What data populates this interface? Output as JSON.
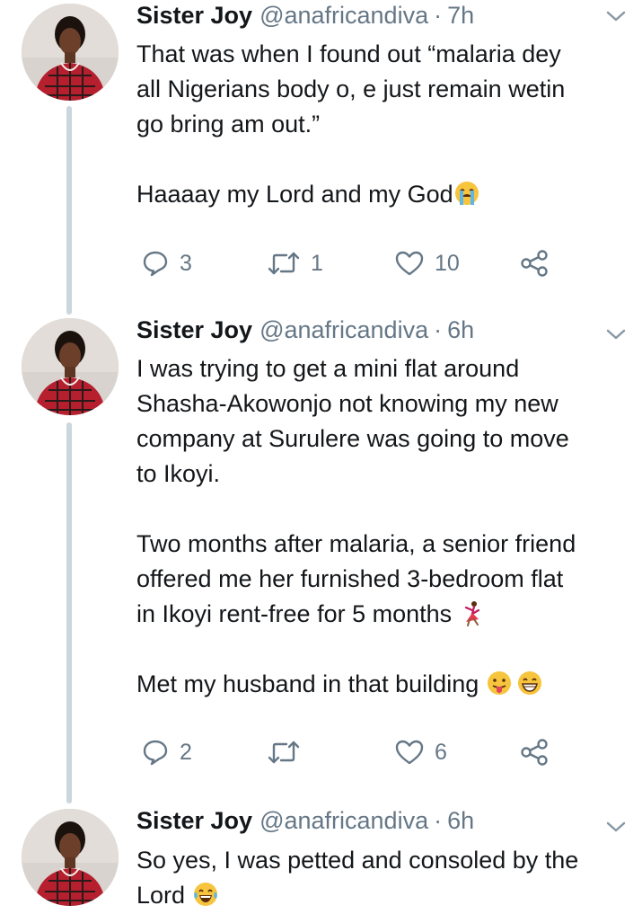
{
  "tweets": [
    {
      "name": "Sister Joy",
      "handle": "@anafricandiva",
      "separator": "·",
      "time": "7h",
      "lines": [
        "That was when I found out “malaria dey",
        "all Nigerians body o, e just remain wetin",
        "go bring am out.”",
        "",
        "Haaaay my Lord and my God"
      ],
      "emojis": [
        "crying-face"
      ],
      "replies": "3",
      "retweets": "1",
      "likes": "10"
    },
    {
      "name": "Sister Joy",
      "handle": "@anafricandiva",
      "separator": "·",
      "time": "6h",
      "lines": [
        "I was trying to get a mini flat around",
        "Shasha-Akowonjo not knowing my new",
        "company at Surulere was going to move",
        "to Ikoyi.",
        "",
        "Two months after malaria, a senior friend",
        "offered me her furnished 3-bedroom flat",
        "in Ikoyi rent-free for 5 months",
        "",
        "Met my husband in that building"
      ],
      "emojis": [
        "dancer",
        "tongue-face",
        "grin-face"
      ],
      "replies": "2",
      "retweets": "",
      "likes": "6"
    },
    {
      "name": "Sister Joy",
      "handle": "@anafricandiva",
      "separator": "·",
      "time": "6h",
      "lines": [
        "So yes, I was petted and consoled by the",
        "Lord"
      ],
      "emojis": [
        "tears-of-joy"
      ]
    }
  ],
  "colors": {
    "text": "#14171a",
    "secondary": "#657786",
    "thread_line": "#ccd6dd"
  }
}
